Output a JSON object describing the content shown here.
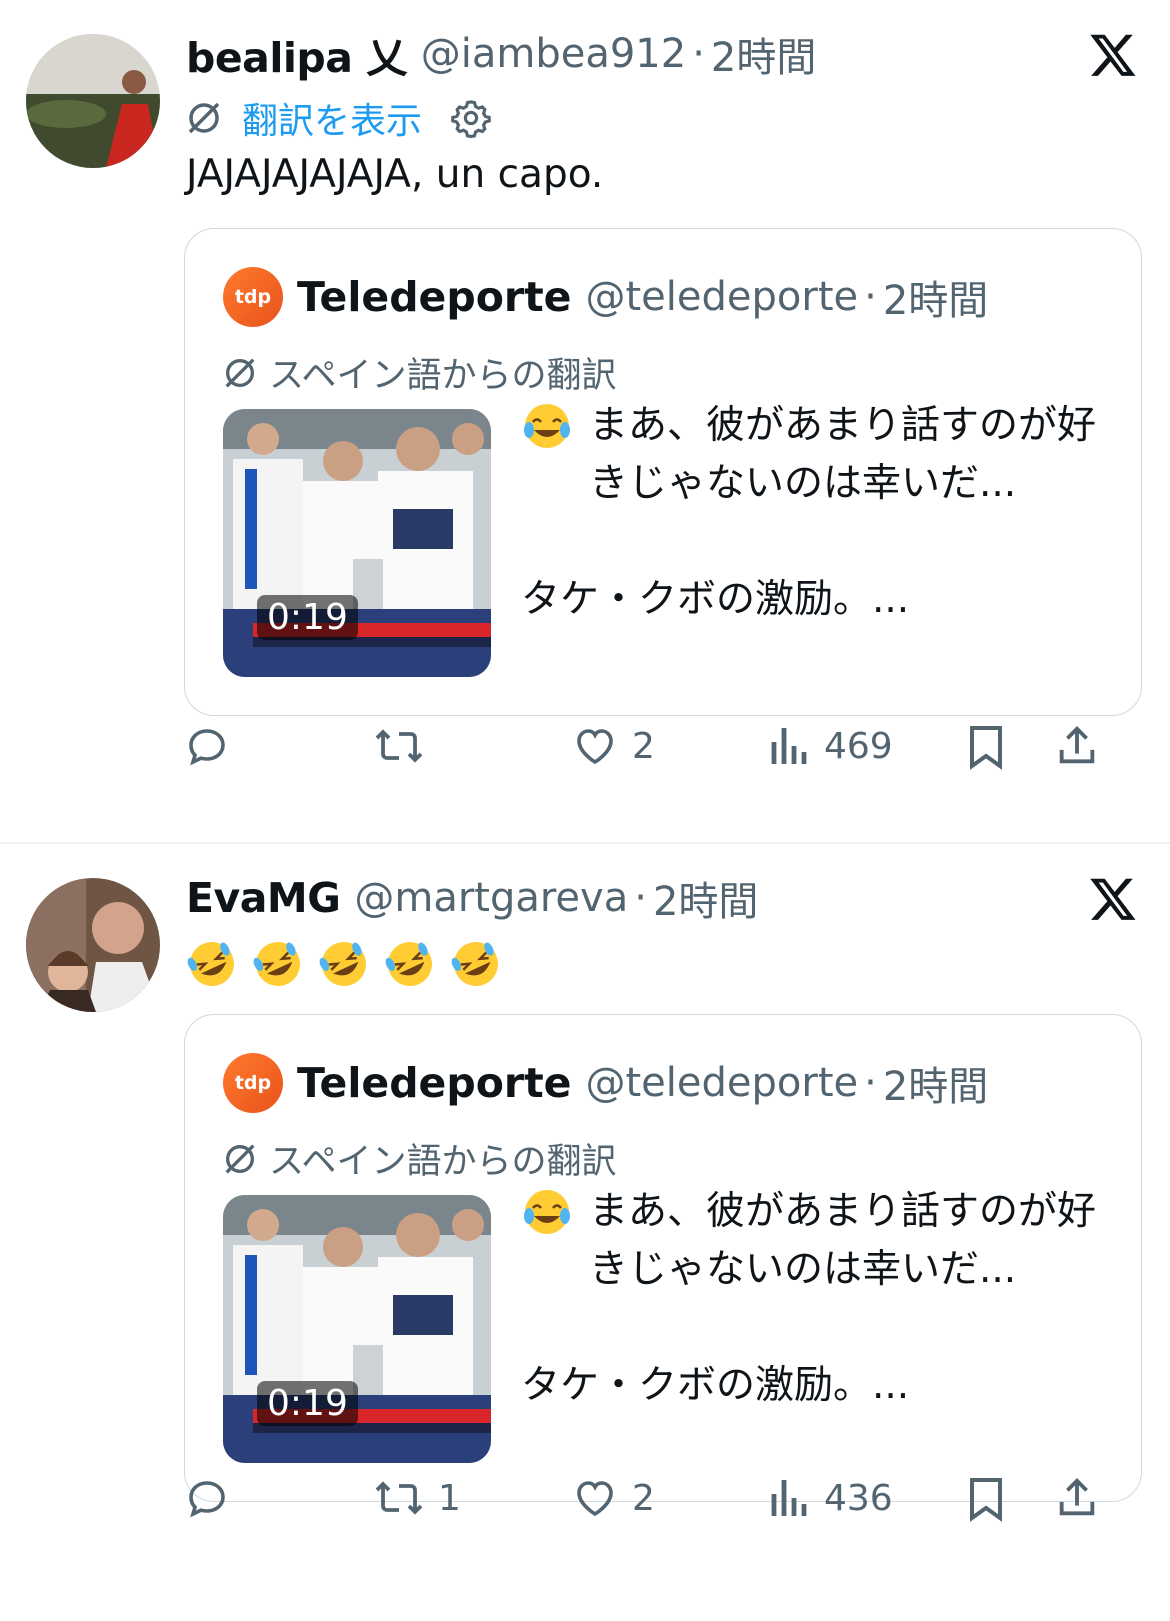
{
  "tweets": [
    {
      "author_name": "bealipa 乂",
      "author_handle": "@iambea912",
      "separator": "·",
      "time": "2時間",
      "translate_link": "翻訳を表示",
      "text": "JAJAJAJAJAJA, un capo.",
      "quote": {
        "logo_text": "tdp",
        "name": "Teledeporte",
        "handle": "@teledeporte",
        "separator": "·",
        "time": "2時間",
        "translated_from": "スペイン語からの翻訳",
        "video_duration": "0:19",
        "text_line1": "まあ、彼があまり話すのが好きじゃないのは幸いだ...",
        "text_line2": "タケ・クボの激励。..."
      },
      "actions": {
        "replies": "",
        "reposts": "",
        "likes": "2",
        "views": "469"
      }
    },
    {
      "author_name": "EvaMG",
      "author_handle": "@martgareva",
      "separator": "·",
      "time": "2時間",
      "emoji_count": 5,
      "quote": {
        "logo_text": "tdp",
        "name": "Teledeporte",
        "handle": "@teledeporte",
        "separator": "·",
        "time": "2時間",
        "translated_from": "スペイン語からの翻訳",
        "video_duration": "0:19",
        "text_line1": "まあ、彼があまり話すのが好きじゃないのは幸いだ...",
        "text_line2": "タケ・クボの激励。..."
      },
      "actions": {
        "replies": "",
        "reposts": "1",
        "likes": "2",
        "views": "436"
      }
    }
  ],
  "colors": {
    "link": "#1d9bf0",
    "muted": "#536471",
    "border": "#cfd9de"
  }
}
